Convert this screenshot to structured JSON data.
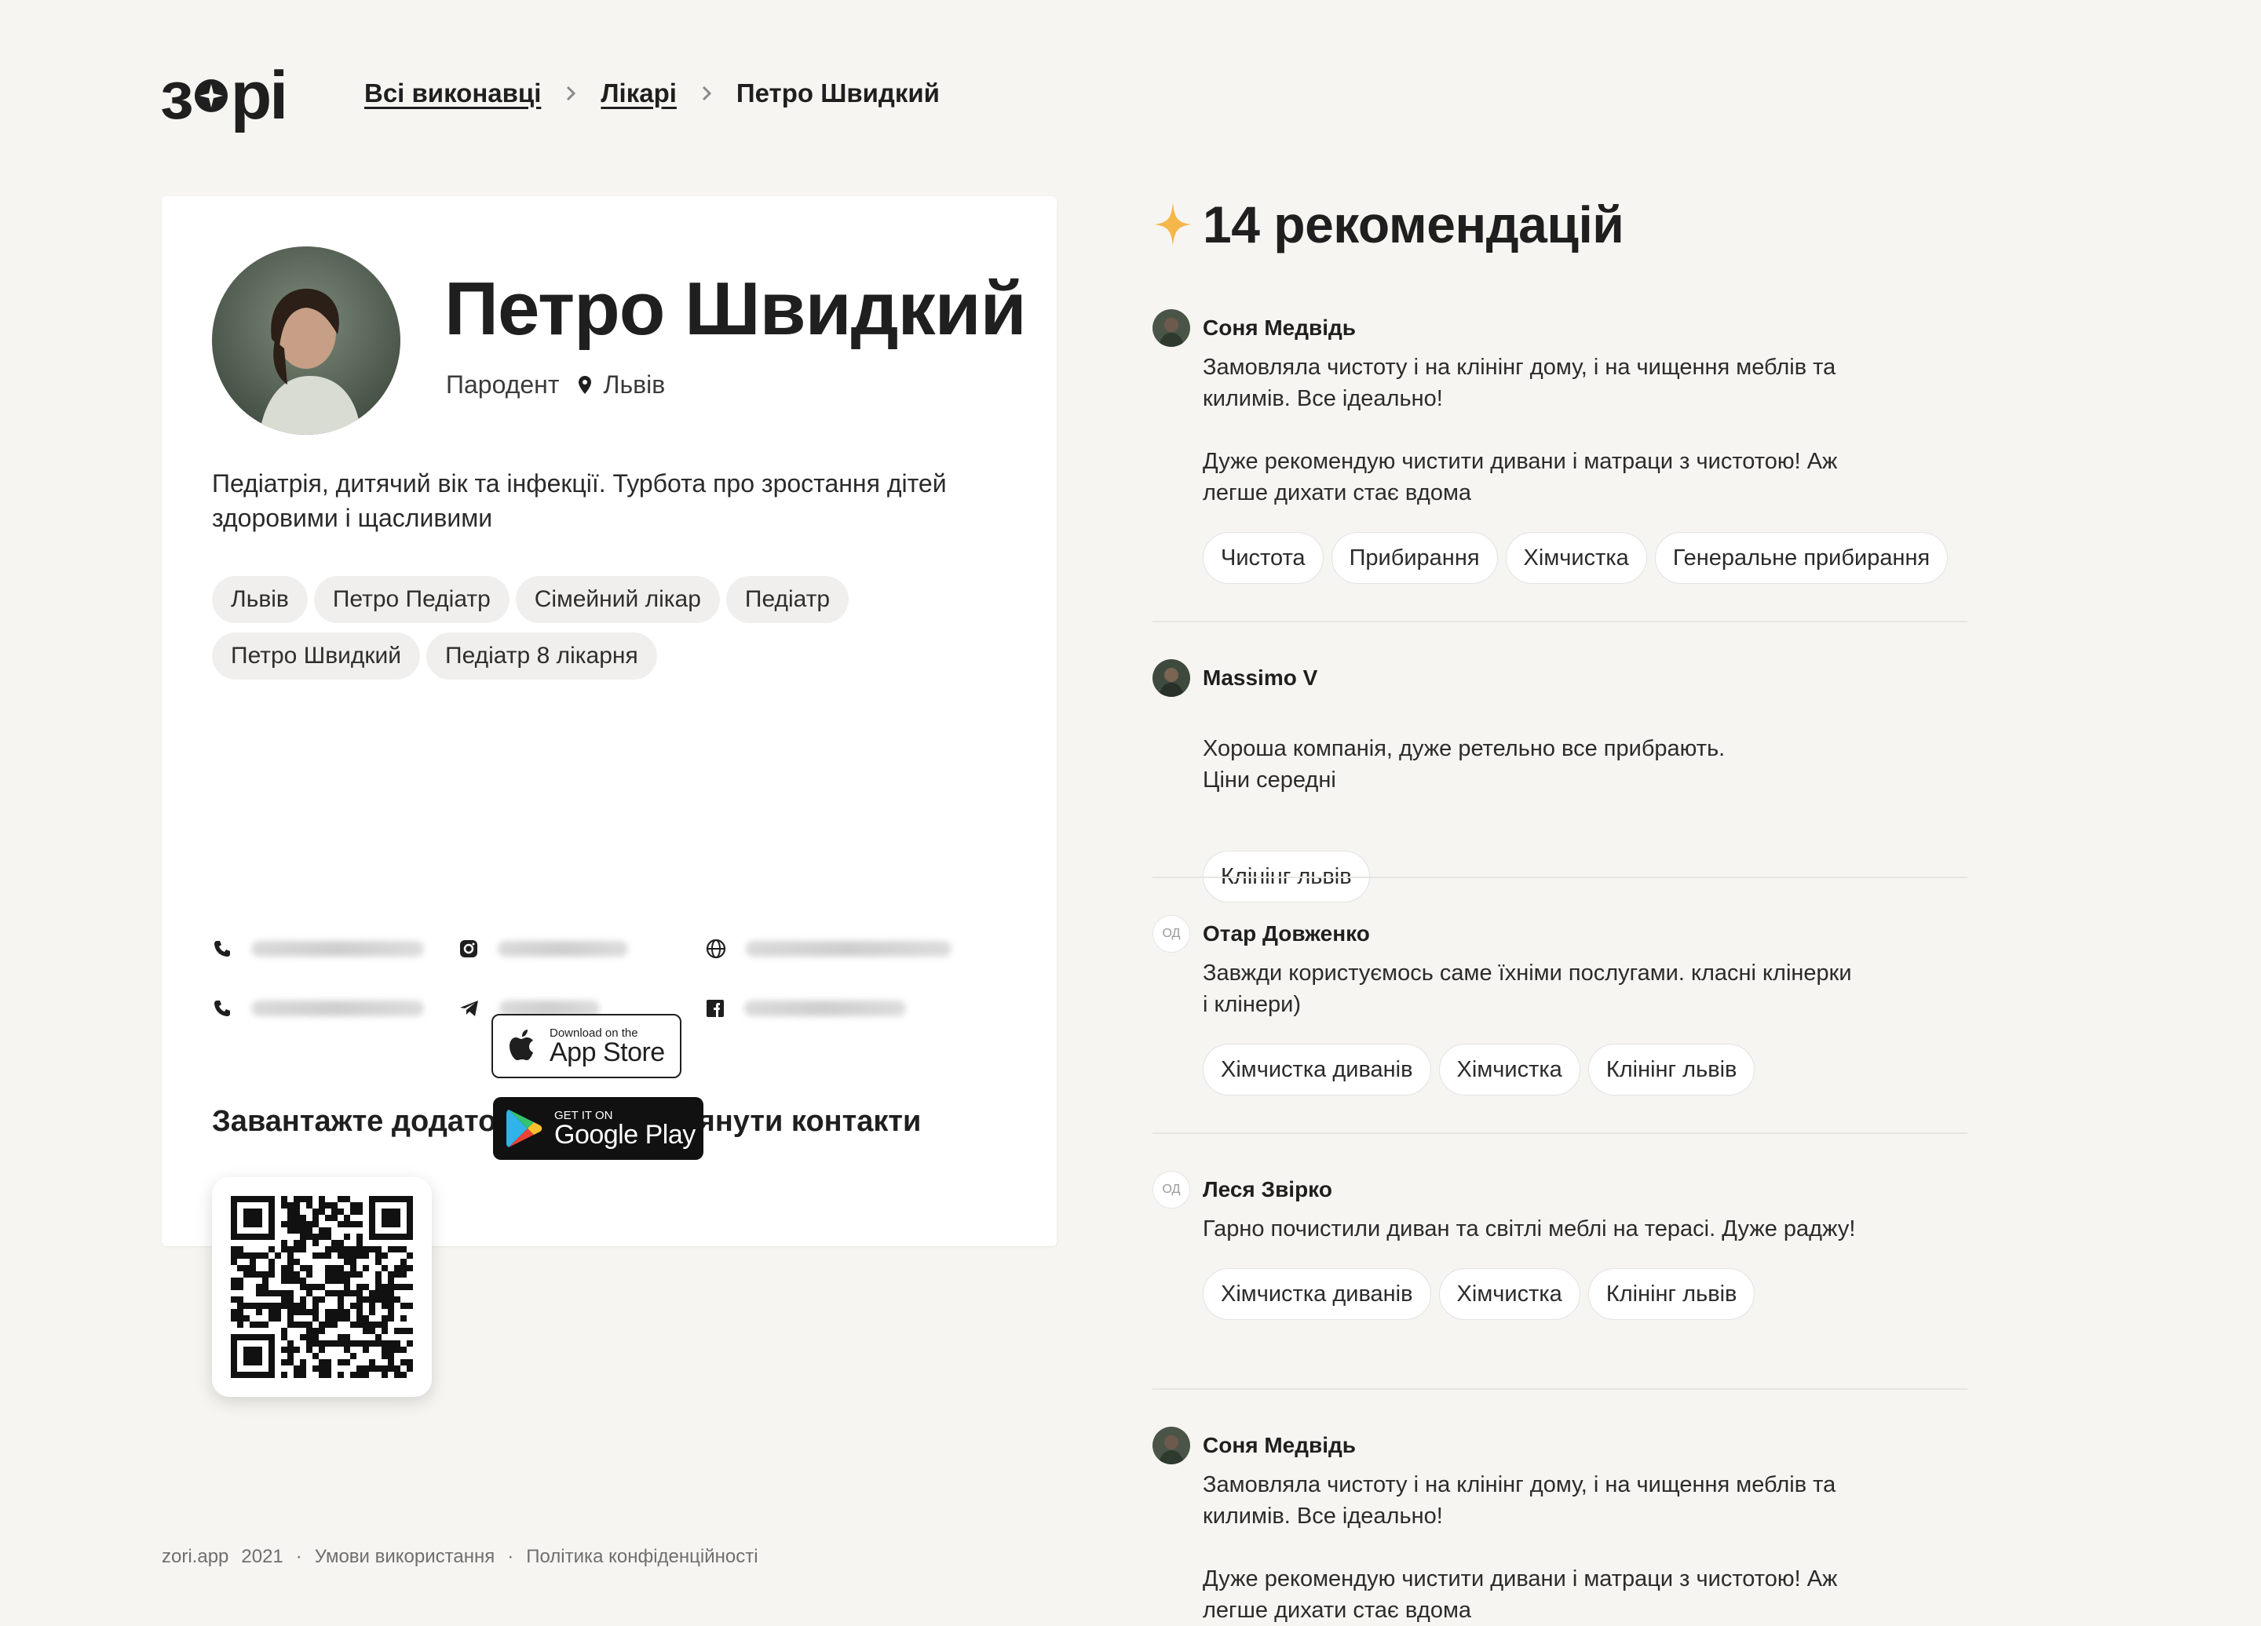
{
  "header": {
    "logo_text": "зорі",
    "breadcrumb": [
      {
        "label": "Всі виконавці"
      },
      {
        "label": "Лікарі"
      },
      {
        "label": "Петро Швидкий"
      }
    ]
  },
  "profile": {
    "name": "Петро Швидкий",
    "profession": "Пародент",
    "city": "Львів",
    "bio": "Педіатрія, дитячий вік та інфекції. Турбота про зростання дітей здоровими і щасливими",
    "tags": [
      "Львів",
      "Петро Педіатр",
      "Сімейний лікар",
      "Педіатр",
      "Петро Швидкий",
      "Педіатр 8 лікарня"
    ],
    "contacts": [
      {
        "icon": "phone-icon",
        "hidden": true
      },
      {
        "icon": "instagram-icon",
        "hidden": true
      },
      {
        "icon": "globe-icon",
        "hidden": true
      },
      {
        "icon": "phone-icon",
        "hidden": true
      },
      {
        "icon": "telegram-icon",
        "hidden": true
      },
      {
        "icon": "facebook-icon",
        "hidden": true
      }
    ],
    "download_title": "Завантажте додаток, щоб переглянути контакти",
    "app_store": {
      "small": "Download on the",
      "big": "App Store"
    },
    "google_play": {
      "small": "GET IT ON",
      "big": "Google Play"
    }
  },
  "recommendations": {
    "count_label": "14 рекомендацій",
    "items": [
      {
        "author": "Соня Медвідь",
        "avatar": "photo",
        "text": [
          "Замовляла чистоту і на клінінг дому, і на чищення меблів та килимів. Все ідеально!",
          "Дуже рекомендую чистити дивани і матраци з чистотою! Аж легше дихати стає вдома"
        ],
        "tags": [
          "Чистота",
          "Прибирання",
          "Хімчистка",
          "Генеральне прибирання"
        ]
      },
      {
        "author": "Massimo V",
        "avatar": "photo",
        "text": [
          "Хороша компанія, дуже ретельно все прибрають.\nЦіни середні"
        ],
        "tags": [
          "Клінінг львів"
        ]
      },
      {
        "author": "Отар Довженко",
        "avatar": "ОД",
        "text": [
          "Завжди користуємось саме їхніми послугами. класні клінерки і клінери)"
        ],
        "tags": [
          "Хімчистка диванів",
          "Хімчистка",
          "Клінінг львів"
        ]
      },
      {
        "author": "Леся Звірко",
        "avatar": "ОД",
        "text": [
          "Гарно почистили диван та світлі меблі на терасі. Дуже раджу!"
        ],
        "tags": [
          "Хімчистка диванів",
          "Хімчистка",
          "Клінінг львів"
        ]
      },
      {
        "author": "Соня Медвідь",
        "avatar": "photo",
        "text": [
          "Замовляла чистоту і на клінінг дому, і на чищення меблів та килимів. Все ідеально!",
          "Дуже рекомендую чистити дивани і матраци з чистотою! Аж легше дихати стає вдома"
        ],
        "tags": []
      }
    ]
  },
  "footer": {
    "site": "zori.app",
    "year": "2021",
    "terms": "Умови використання",
    "privacy": "Політика конфіденційності"
  },
  "colors": {
    "background": "#f6f5f1",
    "card": "#ffffff",
    "accent_star": "#f5b74a",
    "tag_bg": "#f0efed"
  }
}
